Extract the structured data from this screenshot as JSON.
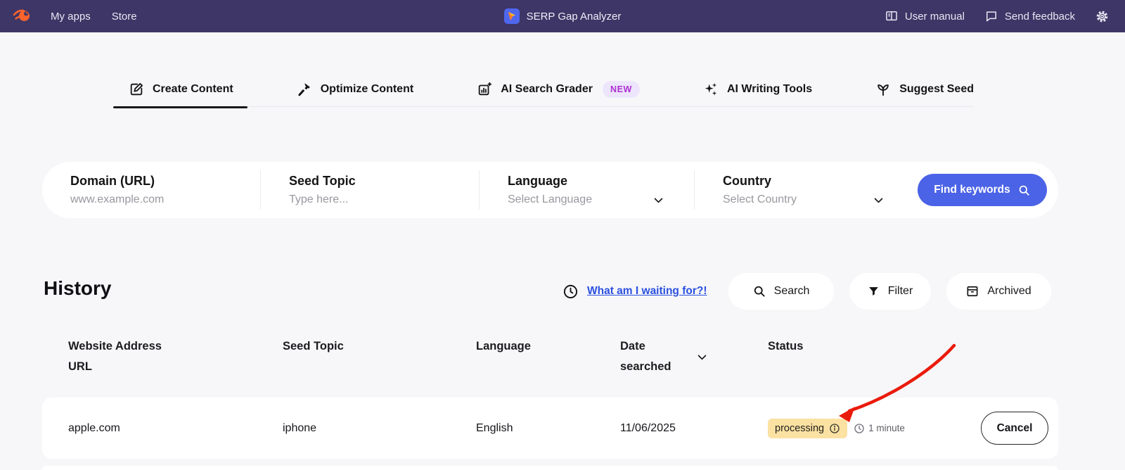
{
  "navbar": {
    "my_apps": "My apps",
    "store": "Store",
    "app_title": "SERP Gap Analyzer",
    "user_manual": "User manual",
    "send_feedback": "Send feedback"
  },
  "tabs": [
    {
      "label": "Create Content",
      "icon": "edit-icon",
      "active": true
    },
    {
      "label": "Optimize Content",
      "icon": "hammer-icon",
      "active": false
    },
    {
      "label": "AI Search Grader",
      "icon": "grader-chart-icon",
      "active": false,
      "badge": "NEW"
    },
    {
      "label": "AI Writing Tools",
      "icon": "sparkles-icon",
      "active": false
    },
    {
      "label": "Suggest Seed",
      "icon": "seedling-icon",
      "active": false
    }
  ],
  "search_form": {
    "fields": [
      {
        "label": "Domain (URL)",
        "placeholder": "www.example.com"
      },
      {
        "label": "Seed Topic",
        "placeholder": "Type here..."
      },
      {
        "label": "Language",
        "value": "Select Language"
      },
      {
        "label": "Country",
        "value": "Select Country"
      }
    ],
    "submit_label": "Find keywords"
  },
  "history": {
    "title": "History",
    "waiting_link": "What am I waiting for?!",
    "actions": {
      "search": "Search",
      "filter": "Filter",
      "archived": "Archived"
    },
    "table": {
      "columns": [
        "Website Address URL",
        "Seed Topic",
        "Language",
        "Date searched",
        "Status"
      ],
      "rows": [
        {
          "url": "apple.com",
          "seed_topic": "iphone",
          "language": "English",
          "date": "11/06/2025",
          "status": "processing",
          "eta": "1 minute",
          "action": "Cancel"
        }
      ]
    }
  },
  "colors": {
    "navbar_bg": "#3d3666",
    "accent_blue": "#4b63e6",
    "link_blue": "#2b50e0",
    "badge_yellow_bg": "#fbe1a2",
    "new_badge_bg": "#ece5fb",
    "new_badge_text": "#ae2fd1",
    "arrow_red": "#ea1b0c",
    "page_bg": "#f7f7f9",
    "logo_orange": "#ff642d"
  }
}
